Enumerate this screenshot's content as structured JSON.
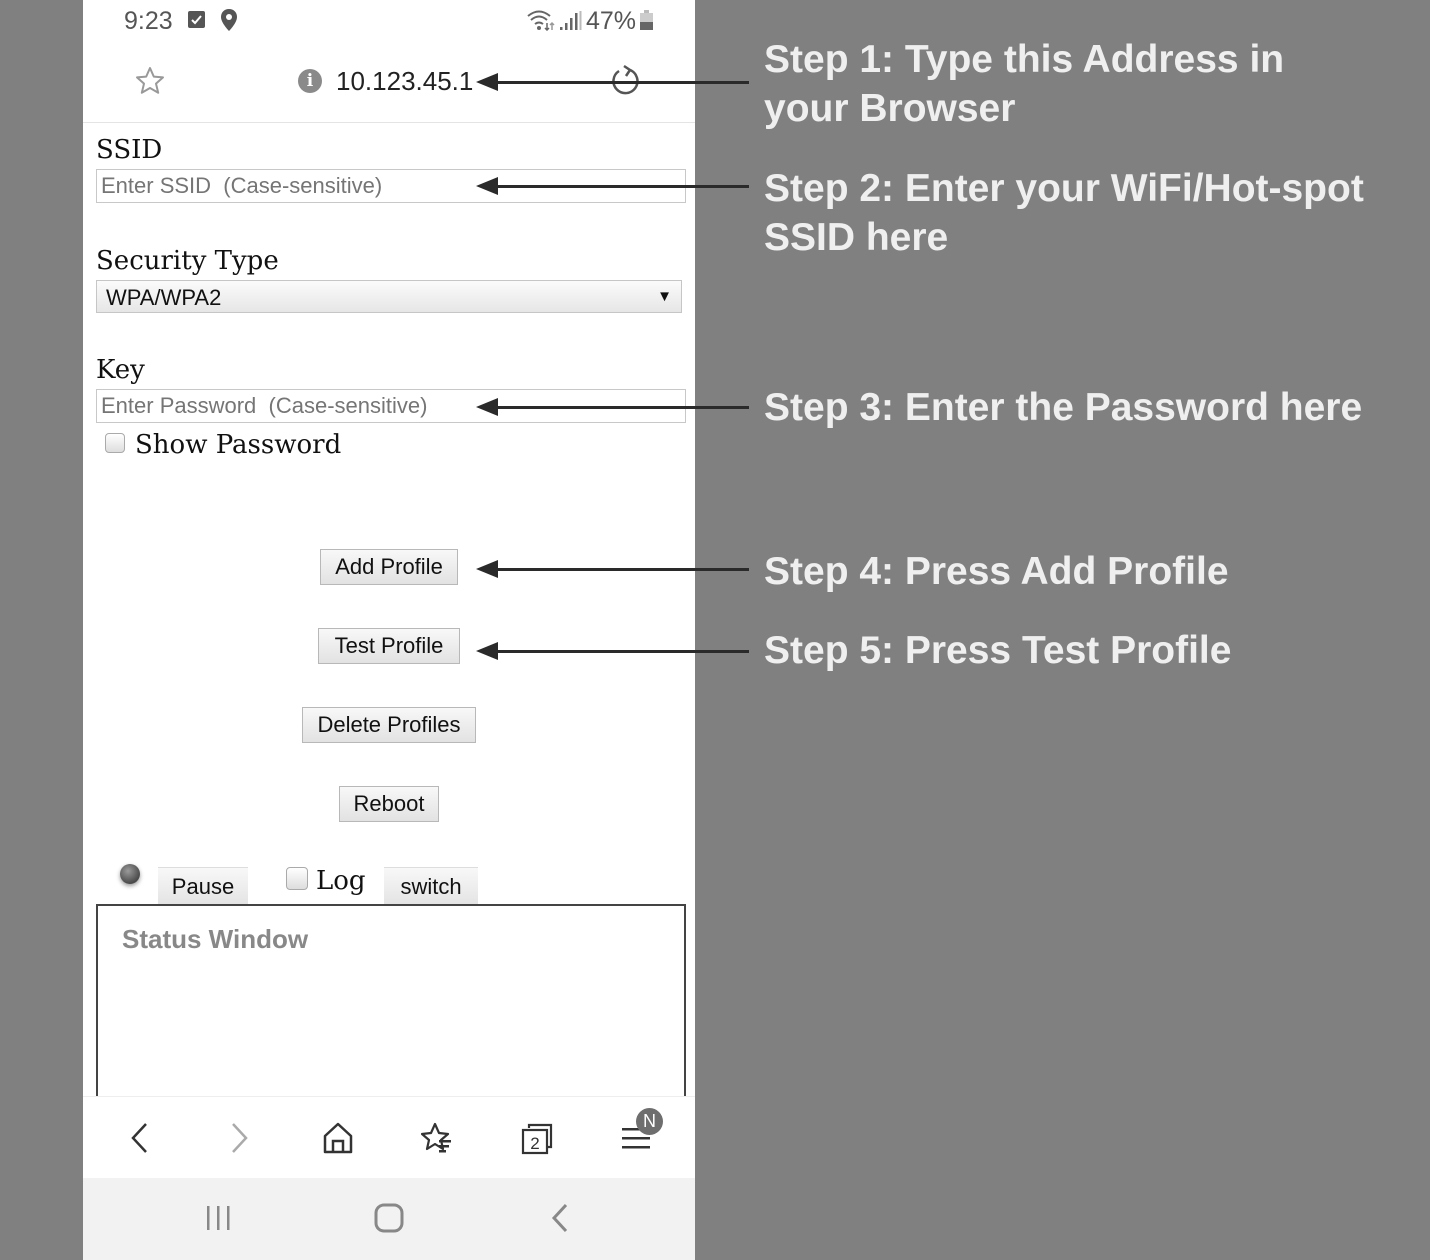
{
  "status_bar": {
    "time": "9:23",
    "notification_icons": [
      "checkbox-icon",
      "location-pin-icon"
    ],
    "system_icons": [
      "wifi-icon",
      "signal-icon",
      "battery-icon"
    ],
    "battery_percent": "47%",
    "battery_level": 0.47
  },
  "url_bar": {
    "address": "10.123.45.1",
    "icons": [
      "star-icon",
      "info-icon",
      "reload-icon"
    ]
  },
  "form": {
    "ssid_label": "SSID",
    "ssid_placeholder": "Enter SSID  (Case-sensitive)",
    "ssid_value": "",
    "security_label": "Security Type",
    "security_selected": "WPA/WPA2",
    "key_label": "Key",
    "key_placeholder": "Enter Password  (Case-sensitive)",
    "key_value": "",
    "show_password_label": "Show Password",
    "show_password_checked": false
  },
  "buttons": {
    "add_profile": "Add Profile",
    "test_profile": "Test Profile",
    "delete_profiles": "Delete Profiles",
    "reboot": "Reboot"
  },
  "status_controls": {
    "pause_label": "Pause",
    "log_label": "Log",
    "log_checked": false,
    "switch_label": "switch",
    "status_window_title": "Status Window"
  },
  "browser_toolbar": {
    "icons": [
      "back-icon",
      "forward-icon",
      "home-icon",
      "bookmarks-icon",
      "tabs-icon",
      "menu-icon"
    ],
    "tab_count": "2",
    "menu_badge": "N"
  },
  "nav_bar": {
    "icons": [
      "recent-apps-icon",
      "home-button-icon",
      "back-button-icon"
    ]
  },
  "annotations": [
    {
      "step": "Step 1: Type this Address in your Browser"
    },
    {
      "step": "Step 2: Enter your WiFi/Hot-spot SSID here"
    },
    {
      "step": "Step 3: Enter the Password here"
    },
    {
      "step": "Step 4: Press Add Profile"
    },
    {
      "step": "Step 5: Press Test Profile"
    }
  ]
}
